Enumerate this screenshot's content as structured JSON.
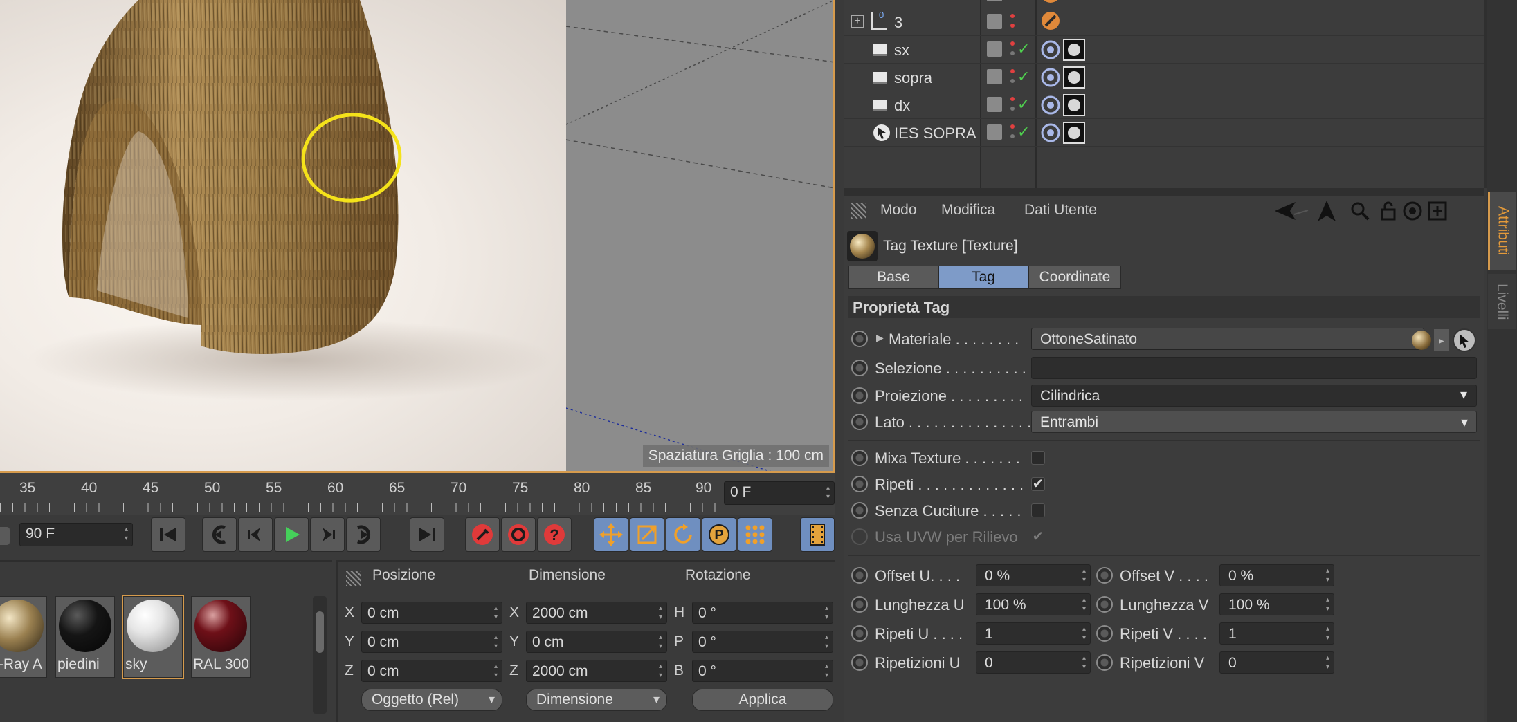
{
  "viewport": {
    "grid_spacing": "Spaziatura Griglia : 100 cm"
  },
  "timeline": {
    "ruler_labels": [
      "35",
      "40",
      "45",
      "50",
      "55",
      "60",
      "65",
      "70",
      "75",
      "80",
      "85",
      "90"
    ],
    "current_frame": "0 F",
    "end_frame": "90 F"
  },
  "materials": [
    {
      "label": "V-Ray A",
      "color": "#9a8050"
    },
    {
      "label": "piedini",
      "color": "#151515"
    },
    {
      "label": "sky",
      "color": "#e6e6e6",
      "selected": true
    },
    {
      "label": "RAL 300",
      "color": "#6e1018"
    }
  ],
  "coords": {
    "headers": {
      "position": "Posizione",
      "size": "Dimensione",
      "rotation": "Rotazione"
    },
    "position": [
      {
        "axis": "X",
        "value": "0 cm"
      },
      {
        "axis": "Y",
        "value": "0 cm"
      },
      {
        "axis": "Z",
        "value": "0 cm"
      }
    ],
    "size": [
      {
        "axis": "X",
        "value": "2000 cm"
      },
      {
        "axis": "Y",
        "value": "0 cm"
      },
      {
        "axis": "Z",
        "value": "2000 cm"
      }
    ],
    "rotation": [
      {
        "axis": "H",
        "value": "0 °"
      },
      {
        "axis": "P",
        "value": "0 °"
      },
      {
        "axis": "B",
        "value": "0 °"
      }
    ],
    "mode_dropdown": "Oggetto (Rel)",
    "size_dropdown": "Dimensione",
    "apply_button": "Applica"
  },
  "objects": {
    "rows": [
      {
        "name": "3",
        "kind": "null"
      },
      {
        "name": "sx",
        "kind": "light"
      },
      {
        "name": "sopra",
        "kind": "light"
      },
      {
        "name": "dx",
        "kind": "light"
      },
      {
        "name": "IES SOPRA",
        "kind": "ies"
      }
    ],
    "null_badge": "0"
  },
  "attributes": {
    "menu": {
      "mode": "Modo",
      "edit": "Modifica",
      "user_data": "Dati Utente"
    },
    "title": "Tag Texture [Texture]",
    "tabs": [
      {
        "label": "Base",
        "active": false
      },
      {
        "label": "Tag",
        "active": true
      },
      {
        "label": "Coordinate",
        "active": false
      }
    ],
    "section_title": "Proprietà Tag",
    "material_label": "Materiale . . . . . . . .",
    "material_value": "OttoneSatinato",
    "selection_label": "Selezione . . . . . . . . . .",
    "selection_value": "",
    "projection_label": "Proiezione . . . . . . . . .",
    "projection_value": "Cilindrica",
    "side_label": "Lato . . . . . . . . . . . . . . .",
    "side_value": "Entrambi",
    "mix_label": "Mixa Texture . . . . . . .",
    "mix_checked": false,
    "tile_label": "Ripeti . . . . . . . . . . . . .",
    "tile_checked": true,
    "seamless_label": "Senza Cuciture . . . . .",
    "seamless_checked": false,
    "uvw_label": "Usa UVW per Rilievo",
    "uvw_checked": true,
    "check_glyph": "✔",
    "offset_u_label": "Offset U. . . .",
    "offset_u": "0 %",
    "offset_v_label": "Offset V . . . .",
    "offset_v": "0 %",
    "length_u_label": "Lunghezza U",
    "length_u": "100 %",
    "length_v_label": "Lunghezza V",
    "length_v": "100 %",
    "tiles_u_label": "Ripeti U . . . .",
    "tiles_u": "1",
    "tiles_v_label": "Ripeti V . . . .",
    "tiles_v": "1",
    "repetitions_u_label": "Ripetizioni U",
    "repetitions_u": "0",
    "repetitions_v_label": "Ripetizioni V",
    "repetitions_v": "0"
  },
  "side_tabs": {
    "attributes": "Attributi",
    "layers": "Livelli"
  },
  "colors": {
    "accent": "#d69b4d",
    "tab_active": "#7e9bc8",
    "annotation": "#f4e21a"
  }
}
